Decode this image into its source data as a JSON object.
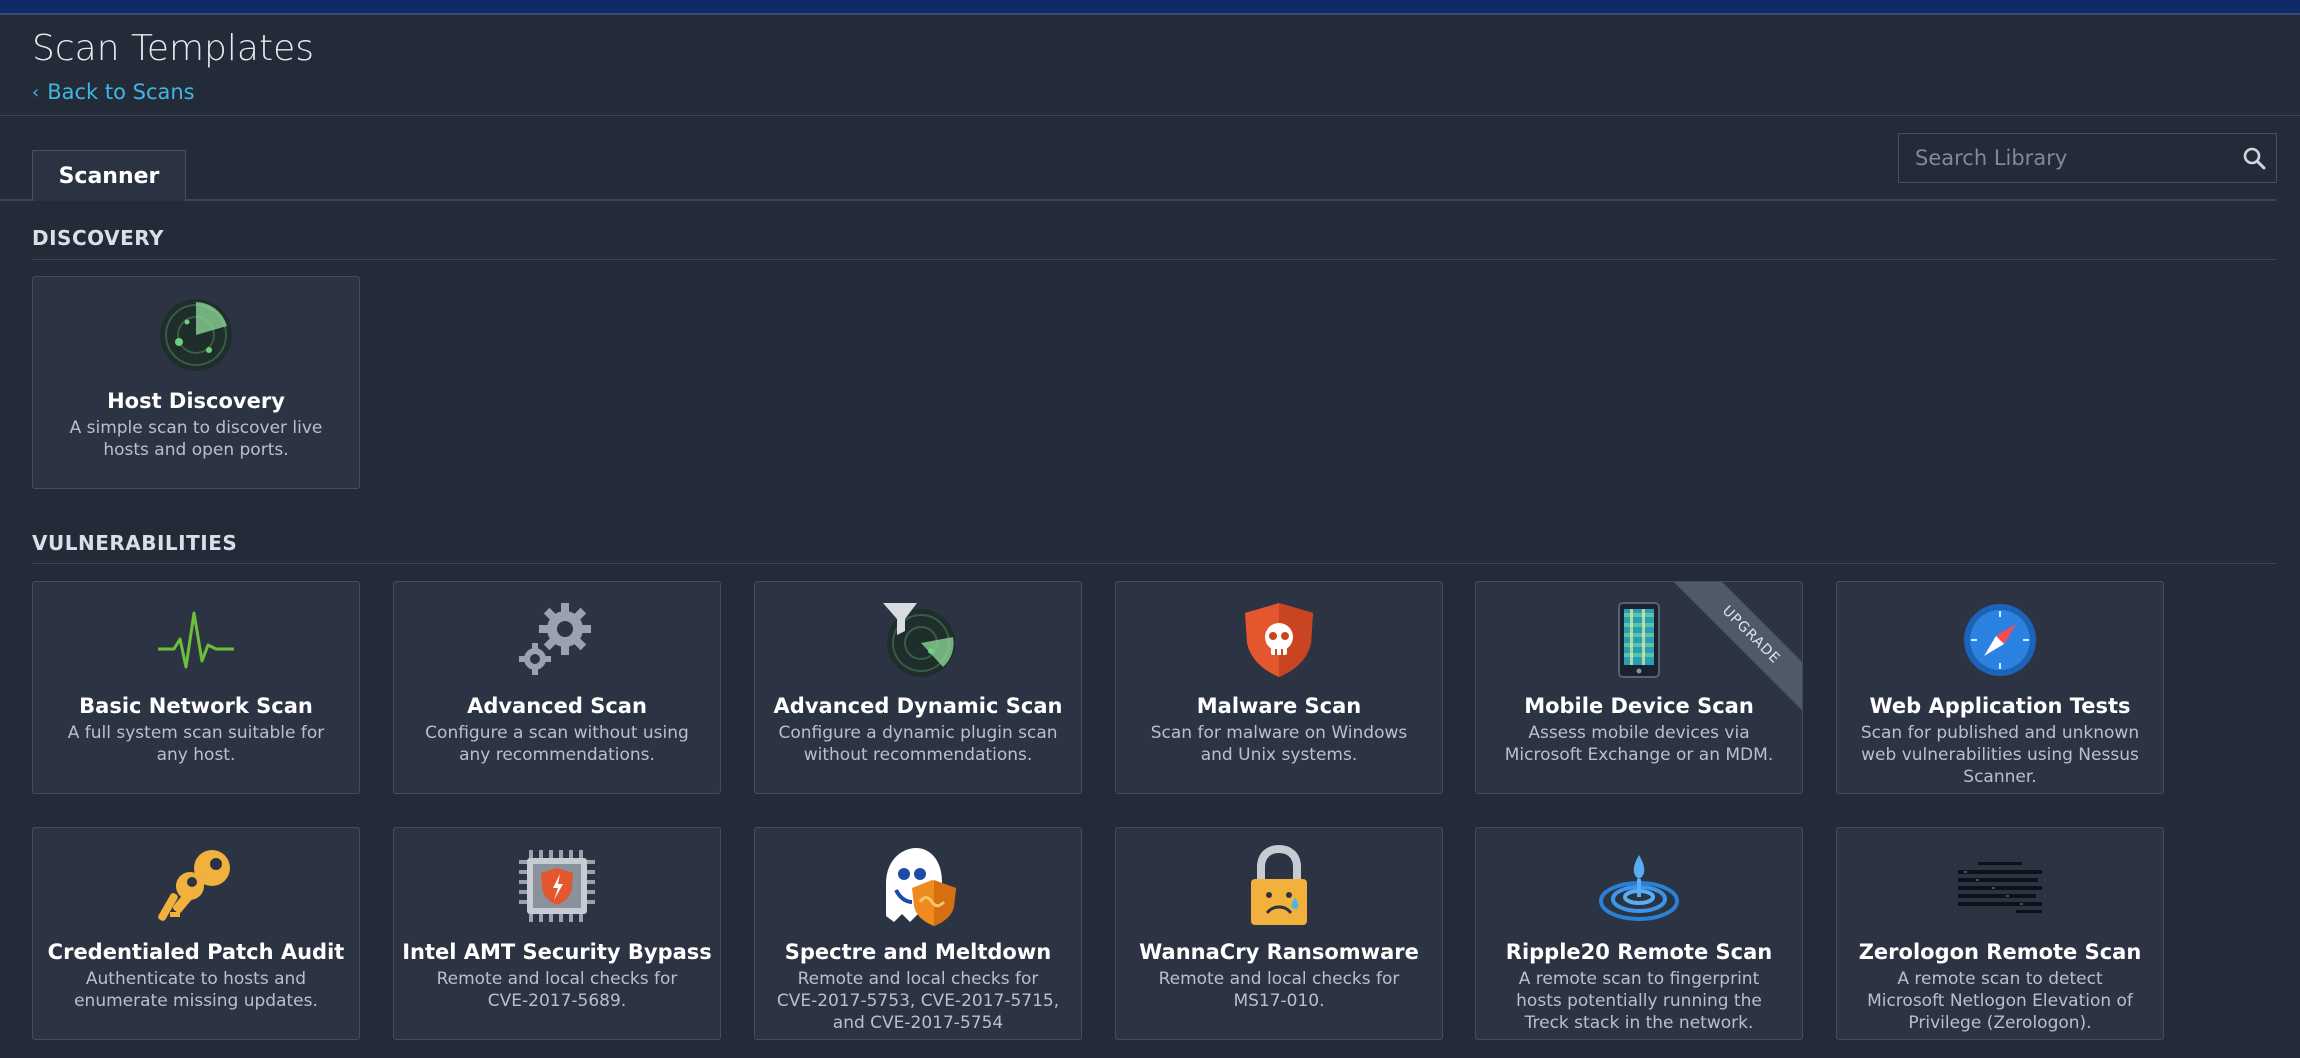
{
  "header": {
    "title": "Scan Templates",
    "back_label": "Back to Scans"
  },
  "tabs": [
    {
      "label": "Scanner",
      "active": true
    }
  ],
  "search": {
    "placeholder": "Search Library"
  },
  "sections": {
    "discovery": "DISCOVERY",
    "vulnerabilities": "VULNERABILITIES"
  },
  "cards": {
    "host_discovery": {
      "title": "Host Discovery",
      "desc": "A simple scan to discover live hosts and open ports.",
      "icon": "radar-icon"
    },
    "basic_network": {
      "title": "Basic Network Scan",
      "desc": "A full system scan suitable for any host.",
      "icon": "pulse-icon"
    },
    "advanced": {
      "title": "Advanced Scan",
      "desc": "Configure a scan without using any recommendations.",
      "icon": "gears-icon"
    },
    "advanced_dynamic": {
      "title": "Advanced Dynamic Scan",
      "desc": "Configure a dynamic plugin scan without recommendations.",
      "icon": "filter-radar-icon"
    },
    "malware": {
      "title": "Malware Scan",
      "desc": "Scan for malware on Windows and Unix systems.",
      "icon": "skull-shield-icon"
    },
    "mobile": {
      "title": "Mobile Device Scan",
      "desc": "Assess mobile devices via Microsoft Exchange or an MDM.",
      "icon": "mobile-icon",
      "badge": "UPGRADE"
    },
    "webapp": {
      "title": "Web Application Tests",
      "desc": "Scan for published and unknown web vulnerabilities using Nessus Scanner.",
      "icon": "compass-icon"
    },
    "patch_audit": {
      "title": "Credentialed Patch Audit",
      "desc": "Authenticate to hosts and enumerate missing updates.",
      "icon": "keys-icon"
    },
    "intel_amt": {
      "title": "Intel AMT Security Bypass",
      "desc": "Remote and local checks for CVE-2017-5689.",
      "icon": "chip-icon"
    },
    "spectre": {
      "title": "Spectre and Meltdown",
      "desc": "Remote and local checks for CVE-2017-5753, CVE-2017-5715, and CVE-2017-5754",
      "icon": "ghost-shield-icon"
    },
    "wannacry": {
      "title": "WannaCry Ransomware",
      "desc": "Remote and local checks for MS17-010.",
      "icon": "padlock-icon"
    },
    "ripple20": {
      "title": "Ripple20 Remote Scan",
      "desc": "A remote scan to fingerprint hosts potentially running the Treck stack in the network.",
      "icon": "ripple-icon"
    },
    "zerologon": {
      "title": "Zerologon Remote Scan",
      "desc": "A remote scan to detect Microsoft Netlogon Elevation of Privilege (Zerologon).",
      "icon": "code-icon"
    }
  }
}
